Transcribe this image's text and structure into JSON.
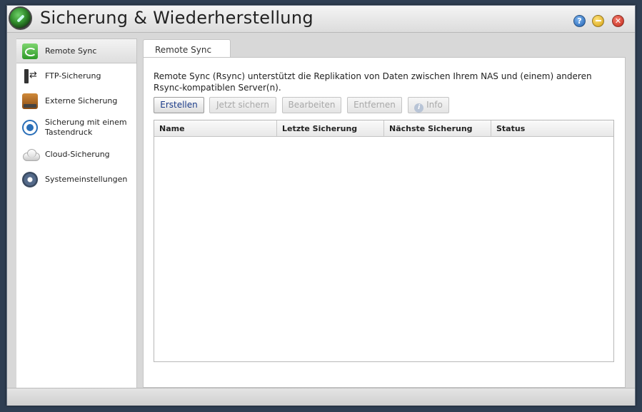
{
  "window": {
    "title": "Sicherung & Wiederherstellung",
    "controls": {
      "help": "?",
      "minimize": "minimize",
      "close": "close"
    }
  },
  "sidebar": {
    "items": [
      {
        "label": "Remote Sync",
        "icon": "remote-sync-icon",
        "active": true
      },
      {
        "label": "FTP-Sicherung",
        "icon": "ftp-icon",
        "active": false
      },
      {
        "label": "Externe Sicherung",
        "icon": "external-drive-icon",
        "active": false
      },
      {
        "label": "Sicherung mit einem Tastendruck",
        "icon": "one-touch-icon",
        "active": false
      },
      {
        "label": "Cloud-Sicherung",
        "icon": "cloud-icon",
        "active": false
      },
      {
        "label": "Systemeinstellungen",
        "icon": "gear-icon",
        "active": false
      }
    ]
  },
  "main": {
    "tab": "Remote Sync",
    "description": "Remote Sync (Rsync) unterstützt die Replikation von Daten zwischen Ihrem NAS und (einem) anderen Rsync-kompatiblen Server(n).",
    "buttons": {
      "create": "Erstellen",
      "backup_now": "Jetzt sichern",
      "edit": "Bearbeiten",
      "remove": "Entfernen",
      "info": "Info"
    },
    "table": {
      "columns": [
        "Name",
        "Letzte Sicherung",
        "Nächste Sicherung",
        "Status"
      ],
      "rows": []
    }
  }
}
